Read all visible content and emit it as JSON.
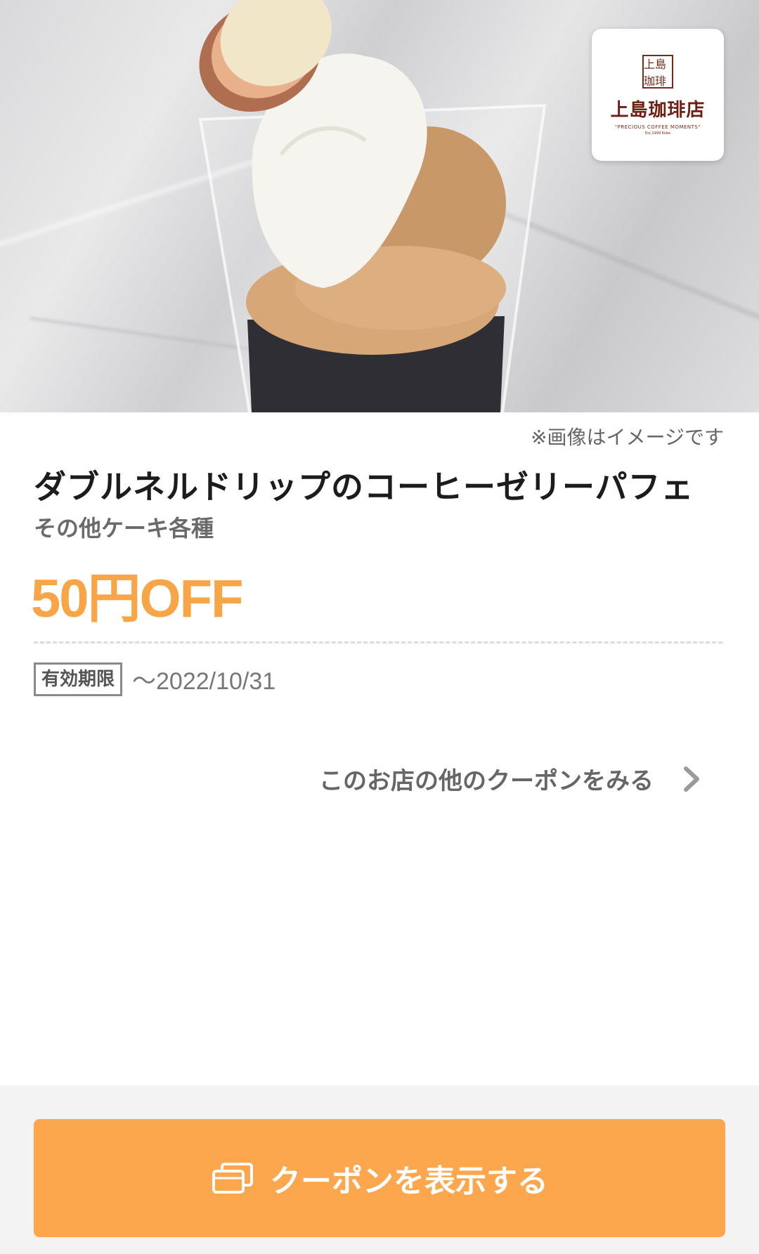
{
  "hero": {
    "image_label": "coffee-jelly-parfait-photo",
    "note": "※画像はイメージです"
  },
  "logo": {
    "mark": "上島珈琲",
    "name": "上島珈琲店",
    "tagline": "\"PRECIOUS COFFEE MOMENTS\"",
    "est": "Est.1999 Kobe"
  },
  "product": {
    "title": "ダブルネルドリップのコーヒーゼリーパフェ",
    "subtitle": "その他ケーキ各種",
    "discount": "50円OFF"
  },
  "validity": {
    "label": "有効期限",
    "date": "〜2022/10/31"
  },
  "links": {
    "more_coupons": "このお店の他のクーポンをみる"
  },
  "cta": {
    "label": "クーポンを表示する",
    "icon": "ticket-icon"
  },
  "colors": {
    "accent": "#fca74d",
    "discount_text": "#f8a548"
  }
}
